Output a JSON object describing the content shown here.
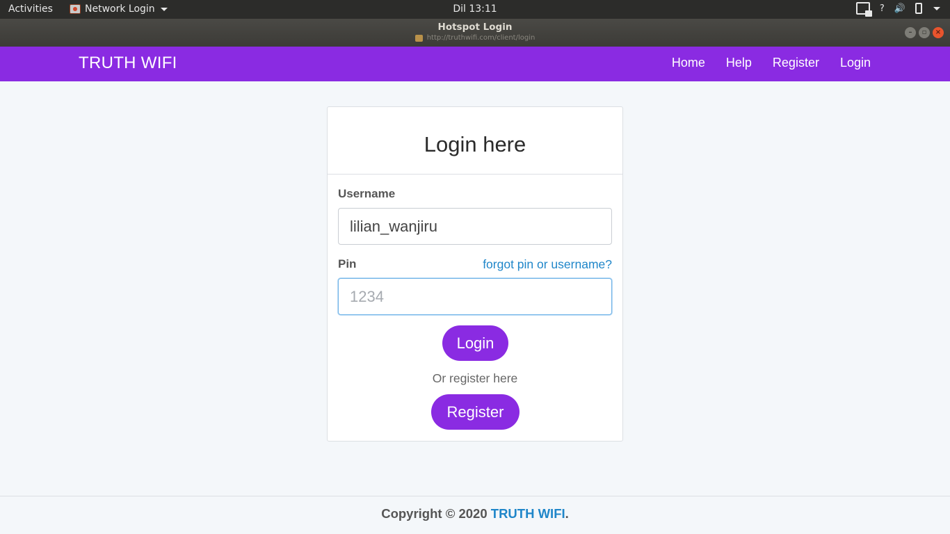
{
  "system": {
    "activities": "Activities",
    "app_menu": "Network Login",
    "clock": "Dil 13:11",
    "help_glyph": "?",
    "volume_glyph": "🔊"
  },
  "window": {
    "title": "Hotspot Login",
    "url": "http://truthwifi.com/client/login"
  },
  "navbar": {
    "brand": "TRUTH WIFI",
    "links": [
      "Home",
      "Help",
      "Register",
      "Login"
    ],
    "color": "#8a2be2"
  },
  "login": {
    "heading": "Login here",
    "username_label": "Username",
    "username_value": "lilian_wanjiru",
    "pin_label": "Pin",
    "forgot_link": "forgot pin or username?",
    "pin_placeholder": "1234",
    "login_button": "Login",
    "or_text": "Or register here",
    "register_button": "Register"
  },
  "footer": {
    "text": "Copyright © 2020 ",
    "link": "TRUTH WIFI",
    "suffix": "."
  },
  "colors": {
    "accent": "#8a2be2",
    "link": "#1f86c9"
  }
}
